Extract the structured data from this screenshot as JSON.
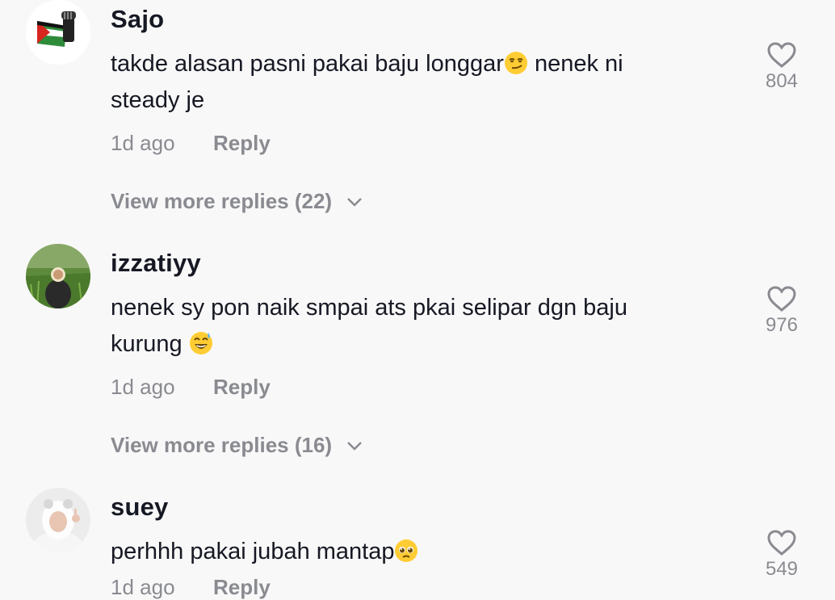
{
  "comments": [
    {
      "username": "Sajo",
      "text_a": "takde alasan pasni pakai baju longgar",
      "emoji_a": "smirking-face",
      "text_b": " nenek ni steady je",
      "time": "1d ago",
      "reply": "Reply",
      "more": "View more replies (22)",
      "likes": "804"
    },
    {
      "username": "izzatiyy",
      "text_a": "nenek sy pon naik smpai ats pkai selipar dgn baju kurung ",
      "emoji_a": "grinning-sweat-face",
      "text_b": "",
      "time": "1d ago",
      "reply": "Reply",
      "more": "View more replies (16)",
      "likes": "976"
    },
    {
      "username": "suey",
      "text_a": "perhhh pakai jubah mantap",
      "emoji_a": "pleading-face",
      "text_b": "",
      "time": "1d ago",
      "reply": "Reply",
      "likes": "549"
    }
  ],
  "colors": {
    "background": "#f8f8f8",
    "text": "#161823",
    "muted": "#8a8b91"
  }
}
